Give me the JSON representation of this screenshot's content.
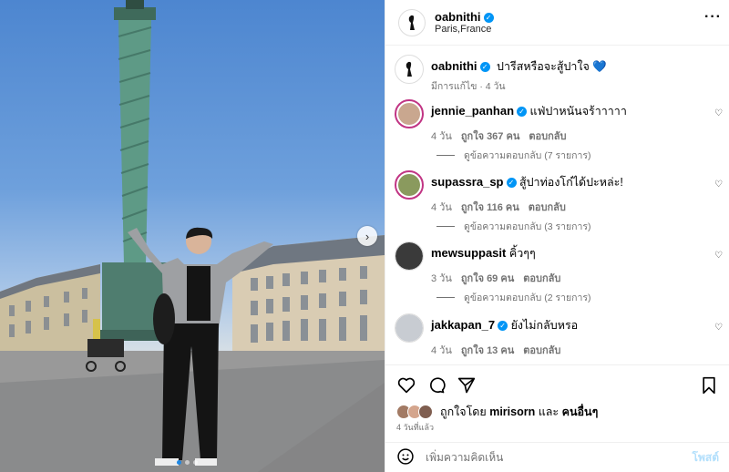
{
  "post": {
    "author": "oabnithi",
    "location": "Paris,France",
    "caption": "ปารีสหรือจะสู้ปาใจ",
    "caption_emoji": "💙",
    "edited": "มีการแก้ไข · 4 วัน",
    "slide_count": 3,
    "active_slide": 1
  },
  "comments": [
    {
      "user": "jennie_panhan",
      "text": "แฟ่ปาหนันจร้าาาาา",
      "time": "4 วัน",
      "likes": "ถูกใจ 367 คน",
      "reply": "ตอบกลับ",
      "view_replies": "ดูข้อความตอบกลับ (7 รายการ)"
    },
    {
      "user": "supassra_sp",
      "text": "สู้ปาท่องโก๋ได้ปะหล่ะ!",
      "time": "4 วัน",
      "likes": "ถูกใจ 116 คน",
      "reply": "ตอบกลับ",
      "view_replies": "ดูข้อความตอบกลับ (3 รายการ)"
    },
    {
      "user": "mewsuppasit",
      "text": "คิ้วๆๆ",
      "time": "3 วัน",
      "likes": "ถูกใจ 69 คน",
      "reply": "ตอบกลับ",
      "view_replies": "ดูข้อความตอบกลับ (2 รายการ)"
    },
    {
      "user": "jakkapan_7",
      "text": "ยังไม่กลับหรอ",
      "time": "4 วัน",
      "likes": "ถูกใจ 13 คน",
      "reply": "ตอบกลับ"
    }
  ],
  "likes_line": {
    "prefix": "ถูกใจโดย",
    "user": "mirisorn",
    "and": "และ",
    "others": "คนอื่นๆ"
  },
  "posted_ago": "4 วันที่แล้ว",
  "add_comment": {
    "placeholder": "เพิ่มความคิดเห็น",
    "post": "โพสต์"
  },
  "icons": {
    "more": "more-horizontal-icon",
    "heart": "heart-icon",
    "comment": "comment-icon",
    "share": "share-icon",
    "save": "bookmark-icon",
    "emoji": "emoji-icon",
    "next": "chevron-right-icon",
    "verified": "verified-badge-icon"
  },
  "colors": {
    "accent": "#0095f6",
    "muted": "#737373",
    "ring": "#c13584"
  }
}
